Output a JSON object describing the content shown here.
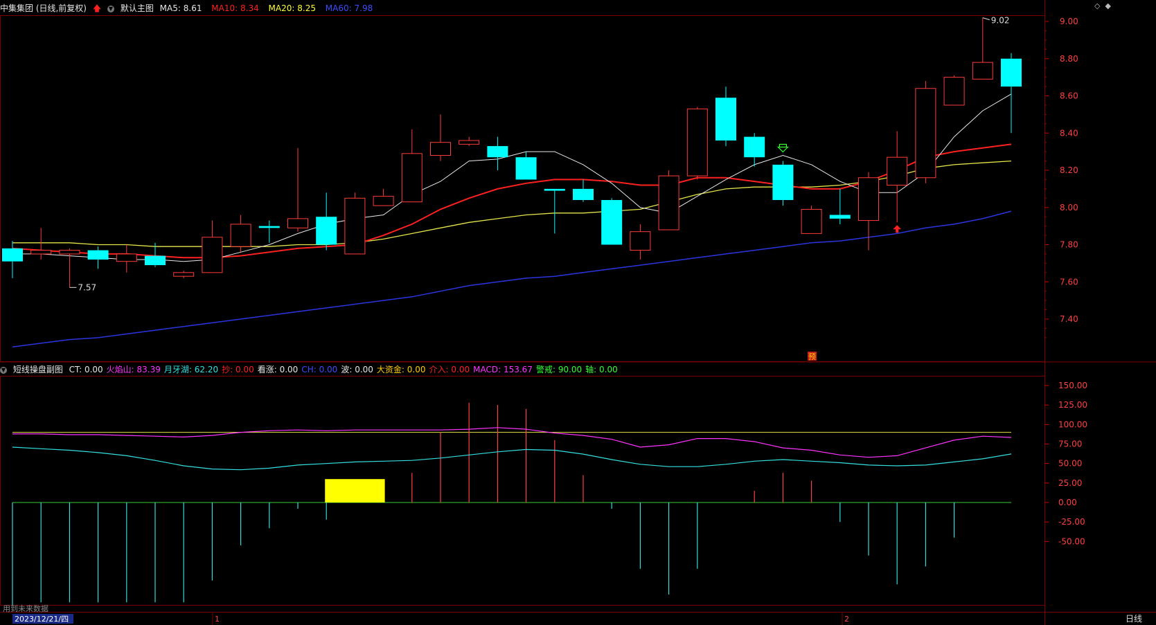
{
  "header": {
    "stock_name": "中集集团 (日线,前复权)",
    "indicator_name": "默认主图",
    "ma5_label": "MA5:",
    "ma5_value": "8.61",
    "ma10_label": "MA10:",
    "ma10_value": "8.34",
    "ma20_label": "MA20:",
    "ma20_value": "8.25",
    "ma60_label": "MA60:",
    "ma60_value": "7.98"
  },
  "sub_header": {
    "name": "短线操盘副图",
    "items": [
      {
        "label": "CT:",
        "value": "0.00",
        "color": "#e6e6e6"
      },
      {
        "label": "火焰山:",
        "value": "83.39",
        "color": "#ff33ff"
      },
      {
        "label": "月牙湖:",
        "value": "62.20",
        "color": "#33e0e0"
      },
      {
        "label": "抄:",
        "value": "0.00",
        "color": "#ff2020"
      },
      {
        "label": "看涨:",
        "value": "0.00",
        "color": "#e6e6e6"
      },
      {
        "label": "CH:",
        "value": "0.00",
        "color": "#3a4dff"
      },
      {
        "label": "波:",
        "value": "0.00",
        "color": "#e6e6e6"
      },
      {
        "label": "大资金:",
        "value": "0.00",
        "color": "#ffcc00"
      },
      {
        "label": "介入:",
        "value": "0.00",
        "color": "#ff2020"
      },
      {
        "label": "MACD:",
        "value": "153.67",
        "color": "#ff33ff"
      },
      {
        "label": "警戒:",
        "value": "90.00",
        "color": "#33ff33"
      },
      {
        "label": "轴:",
        "value": "0.00",
        "color": "#33ff33"
      }
    ]
  },
  "annotations": {
    "low_label": "7.57",
    "high_label": "9.02",
    "pre_label": "预"
  },
  "bottom_bar": {
    "future_data": "用到未来数据",
    "date": "2023/12/21/四",
    "month_1": "1",
    "month_2": "2",
    "period": "日线"
  },
  "colors": {
    "up": "#ff3b3b",
    "down": "#00ffff",
    "ma5": "#e8e8e8",
    "ma10": "#ff2020",
    "ma20": "#e6e64a",
    "ma60": "#2a35e0",
    "grid": "#7a0000"
  },
  "chart_data": [
    {
      "type": "candlestick",
      "title": "中集集团 (日线,前复权)",
      "ylim": [
        7.2,
        9.05
      ],
      "yticks": [
        "9.00",
        "8.80",
        "8.60",
        "8.40",
        "8.20",
        "8.00",
        "7.80",
        "7.60",
        "7.40"
      ],
      "candles": [
        {
          "o": 7.78,
          "h": 7.82,
          "l": 7.62,
          "c": 7.71
        },
        {
          "o": 7.75,
          "h": 7.89,
          "l": 7.72,
          "c": 7.77
        },
        {
          "o": 7.75,
          "h": 7.78,
          "l": 7.57,
          "c": 7.77
        },
        {
          "o": 7.77,
          "h": 7.79,
          "l": 7.67,
          "c": 7.72
        },
        {
          "o": 7.71,
          "h": 7.8,
          "l": 7.65,
          "c": 7.75
        },
        {
          "o": 7.74,
          "h": 7.81,
          "l": 7.68,
          "c": 7.69
        },
        {
          "o": 7.63,
          "h": 7.66,
          "l": 7.62,
          "c": 7.65
        },
        {
          "o": 7.65,
          "h": 7.93,
          "l": 7.65,
          "c": 7.84
        },
        {
          "o": 7.79,
          "h": 7.96,
          "l": 7.76,
          "c": 7.91
        },
        {
          "o": 7.9,
          "h": 7.93,
          "l": 7.81,
          "c": 7.89
        },
        {
          "o": 7.89,
          "h": 8.32,
          "l": 7.87,
          "c": 7.94
        },
        {
          "o": 7.95,
          "h": 8.08,
          "l": 7.77,
          "c": 7.8
        },
        {
          "o": 7.75,
          "h": 8.08,
          "l": 7.75,
          "c": 8.05
        },
        {
          "o": 8.01,
          "h": 8.1,
          "l": 8.01,
          "c": 8.06
        },
        {
          "o": 8.03,
          "h": 8.42,
          "l": 8.03,
          "c": 8.29
        },
        {
          "o": 8.28,
          "h": 8.5,
          "l": 8.25,
          "c": 8.35
        },
        {
          "o": 8.34,
          "h": 8.38,
          "l": 8.33,
          "c": 8.36
        },
        {
          "o": 8.33,
          "h": 8.38,
          "l": 8.2,
          "c": 8.27
        },
        {
          "o": 8.27,
          "h": 8.3,
          "l": 8.15,
          "c": 8.15
        },
        {
          "o": 8.1,
          "h": 8.1,
          "l": 7.86,
          "c": 8.09
        },
        {
          "o": 8.1,
          "h": 8.15,
          "l": 8.03,
          "c": 8.04
        },
        {
          "o": 8.04,
          "h": 8.05,
          "l": 7.8,
          "c": 7.8
        },
        {
          "o": 7.77,
          "h": 7.91,
          "l": 7.72,
          "c": 7.87
        },
        {
          "o": 7.88,
          "h": 8.2,
          "l": 7.88,
          "c": 8.17
        },
        {
          "o": 8.17,
          "h": 8.54,
          "l": 8.15,
          "c": 8.53
        },
        {
          "o": 8.59,
          "h": 8.65,
          "l": 8.33,
          "c": 8.36
        },
        {
          "o": 8.38,
          "h": 8.4,
          "l": 8.22,
          "c": 8.27
        },
        {
          "o": 8.23,
          "h": 8.25,
          "l": 8.01,
          "c": 8.04
        },
        {
          "o": 7.86,
          "h": 8.01,
          "l": 7.86,
          "c": 7.99
        },
        {
          "o": 7.96,
          "h": 8.1,
          "l": 7.91,
          "c": 7.94
        },
        {
          "o": 7.93,
          "h": 8.19,
          "l": 7.77,
          "c": 8.16
        },
        {
          "o": 8.12,
          "h": 8.41,
          "l": 7.92,
          "c": 8.27
        },
        {
          "o": 8.16,
          "h": 8.68,
          "l": 8.13,
          "c": 8.64
        },
        {
          "o": 8.55,
          "h": 8.71,
          "l": 8.55,
          "c": 8.7
        },
        {
          "o": 8.69,
          "h": 9.02,
          "l": 8.69,
          "c": 8.78
        },
        {
          "o": 8.8,
          "h": 8.83,
          "l": 8.4,
          "c": 8.65
        }
      ],
      "ma5": [
        7.75,
        7.75,
        7.74,
        7.73,
        7.72,
        7.72,
        7.71,
        7.72,
        7.76,
        7.8,
        7.86,
        7.91,
        7.94,
        7.96,
        8.07,
        8.14,
        8.25,
        8.26,
        8.3,
        8.3,
        8.23,
        8.13,
        8.0,
        7.97,
        8.06,
        8.15,
        8.23,
        8.28,
        8.23,
        8.14,
        8.08,
        8.08,
        8.19,
        8.38,
        8.52,
        8.61
      ],
      "ma10": [
        7.78,
        7.77,
        7.76,
        7.75,
        7.75,
        7.74,
        7.73,
        7.73,
        7.74,
        7.76,
        7.78,
        7.79,
        7.8,
        7.85,
        7.91,
        7.99,
        8.05,
        8.1,
        8.13,
        8.15,
        8.15,
        8.14,
        8.12,
        8.12,
        8.16,
        8.16,
        8.14,
        8.12,
        8.1,
        8.1,
        8.14,
        8.2,
        8.27,
        8.3,
        8.32,
        8.34
      ],
      "ma20": [
        7.81,
        7.81,
        7.81,
        7.8,
        7.8,
        7.79,
        7.79,
        7.79,
        7.79,
        7.79,
        7.8,
        7.8,
        7.81,
        7.83,
        7.86,
        7.89,
        7.92,
        7.94,
        7.96,
        7.97,
        7.97,
        7.98,
        7.99,
        8.03,
        8.07,
        8.1,
        8.11,
        8.11,
        8.11,
        8.12,
        8.14,
        8.17,
        8.21,
        8.23,
        8.24,
        8.25
      ],
      "ma60": [
        7.25,
        7.27,
        7.29,
        7.3,
        7.32,
        7.34,
        7.36,
        7.38,
        7.4,
        7.42,
        7.44,
        7.46,
        7.48,
        7.5,
        7.52,
        7.55,
        7.58,
        7.6,
        7.62,
        7.63,
        7.65,
        7.67,
        7.69,
        7.71,
        7.73,
        7.75,
        7.77,
        7.79,
        7.81,
        7.82,
        7.84,
        7.86,
        7.89,
        7.91,
        7.94,
        7.98
      ]
    },
    {
      "type": "bar",
      "title": "短线操盘副图",
      "ylim": [
        -75,
        160
      ],
      "yticks": [
        "150.00",
        "125.00",
        "100.00",
        "75.00",
        "50.00",
        "25.00",
        "0.00",
        "-25.00",
        "-50.00"
      ],
      "macd": [
        -132,
        -128,
        -128,
        -128,
        -128,
        -128,
        -128,
        -100,
        -55,
        -33,
        -8,
        -22,
        0,
        0,
        38,
        90,
        128,
        125,
        120,
        80,
        35,
        -8,
        -85,
        -118,
        -85,
        0,
        15,
        38,
        28,
        -25,
        -68,
        -105,
        -82,
        -45,
        0,
        0
      ],
      "firemountain": [
        88,
        88,
        87,
        87,
        86,
        85,
        84,
        86,
        90,
        92,
        93,
        92,
        93,
        93,
        93,
        93,
        94,
        96,
        94,
        89,
        86,
        81,
        71,
        74,
        82,
        82,
        78,
        70,
        67,
        61,
        58,
        60,
        70,
        80,
        85,
        83.39
      ],
      "moonlake": [
        71,
        69,
        67,
        64,
        60,
        54,
        47,
        43,
        42,
        44,
        48,
        50,
        52,
        53,
        54,
        57,
        61,
        65,
        68,
        67,
        62,
        55,
        49,
        46,
        46,
        49,
        53,
        55,
        53,
        51,
        48,
        47,
        48,
        52,
        56,
        62.2
      ],
      "alert": 90,
      "yellow_block": {
        "from_index": 11,
        "to_index": 13,
        "value": 30
      }
    }
  ]
}
